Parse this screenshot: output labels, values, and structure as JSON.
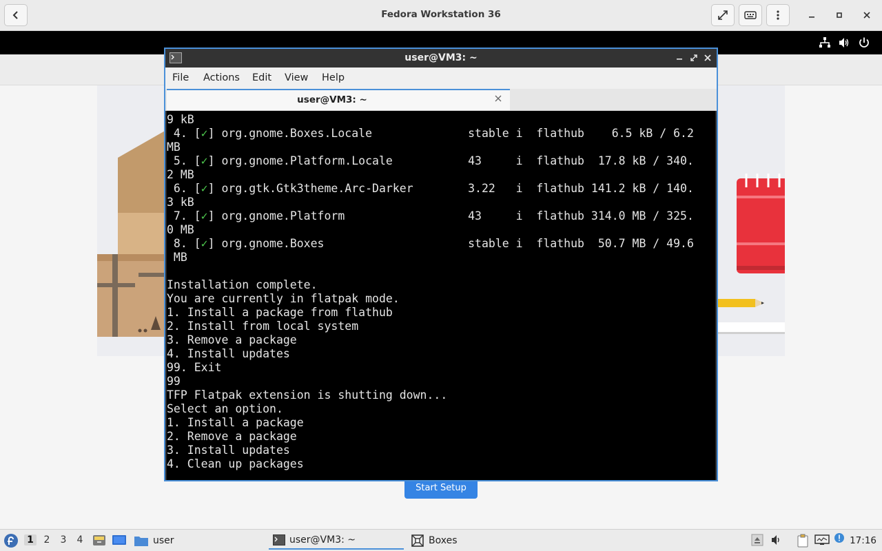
{
  "viewer": {
    "title": "Fedora Workstation 36"
  },
  "background_app": {
    "start_button": "Start Setup"
  },
  "terminal": {
    "title": "user@VM3: ~",
    "menu": [
      "File",
      "Actions",
      "Edit",
      "View",
      "Help"
    ],
    "tab_label": "user@VM3: ~",
    "install_rows": [
      {
        "idx": " 4.",
        "mark": "✓",
        "ref": "org.gnome.Boxes.Locale",
        "branch": "stable",
        "op": "i",
        "remote": "flathub",
        "progress": "6.5 kB / 6.2",
        "wrap": "MB"
      },
      {
        "idx": " 5.",
        "mark": "✓",
        "ref": "org.gnome.Platform.Locale",
        "branch": "43",
        "op": "i",
        "remote": "flathub",
        "progress": "17.8 kB / 340.",
        "wrap": "2 MB"
      },
      {
        "idx": " 6.",
        "mark": "✓",
        "ref": "org.gtk.Gtk3theme.Arc-Darker",
        "branch": "3.22",
        "op": "i",
        "remote": "flathub",
        "progress": "141.2 kB / 140.",
        "wrap": "3 kB"
      },
      {
        "idx": " 7.",
        "mark": "✓",
        "ref": "org.gnome.Platform",
        "branch": "43",
        "op": "i",
        "remote": "flathub",
        "progress": "314.0 MB / 325.",
        "wrap": "0 MB"
      },
      {
        "idx": " 8.",
        "mark": "✓",
        "ref": "org.gnome.Boxes",
        "branch": "stable",
        "op": "i",
        "remote": "flathub",
        "progress": "50.7 MB / 49.6",
        "wrap": " MB"
      }
    ],
    "first_line": "9 kB",
    "output_lines": [
      "",
      "Installation complete.",
      "You are currently in flatpak mode.",
      "1. Install a package from flathub",
      "2. Install from local system",
      "3. Remove a package",
      "4. Install updates",
      "99. Exit",
      "99",
      "TFP Flatpak extension is shutting down...",
      "Select an option.",
      "1. Install a package",
      "2. Remove a package",
      "3. Install updates",
      "4. Clean up packages"
    ]
  },
  "taskbar": {
    "workspaces": [
      "1",
      "2",
      "3",
      "4"
    ],
    "tasks": [
      {
        "label": "user"
      },
      {
        "label": "user@VM3: ~"
      },
      {
        "label": "Boxes"
      }
    ],
    "clock": "17:16"
  }
}
